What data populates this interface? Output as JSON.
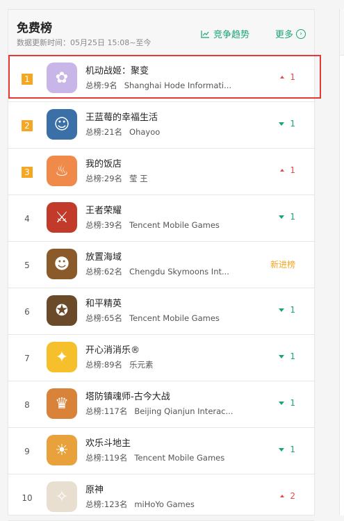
{
  "header": {
    "title": "免费榜",
    "update_time": "数据更新时间：05月25日 15:08~至今",
    "trend_label": "竞争趋势",
    "more_label": "更多"
  },
  "rows": [
    {
      "rank": "1",
      "name": "机动战姬：聚变",
      "overall": "总榜:9名",
      "developer": "Shanghai Hode Informati...",
      "change": "1",
      "direction": "up",
      "icon": "anime-girl-icon",
      "icon_color": "#c8b6e8"
    },
    {
      "rank": "2",
      "name": "王蓝莓的幸福生活",
      "overall": "总榜:21名",
      "developer": "Ohayoo",
      "change": "1",
      "direction": "down",
      "icon": "cartoon-boy-icon",
      "icon_color": "#3a6fa8"
    },
    {
      "rank": "3",
      "name": "我的饭店",
      "overall": "总榜:29名",
      "developer": "莹 王",
      "change": "1",
      "direction": "up",
      "icon": "chef-girl-icon",
      "icon_color": "#f08a4b"
    },
    {
      "rank": "4",
      "name": "王者荣耀",
      "overall": "总榜:39名",
      "developer": "Tencent Mobile Games",
      "change": "1",
      "direction": "down",
      "icon": "hero-warrior-icon",
      "icon_color": "#c23a2a"
    },
    {
      "rank": "5",
      "name": "放置海域",
      "overall": "总榜:62名",
      "developer": "Chengdu Skymoons Int...",
      "change": "新进榜",
      "direction": "new",
      "icon": "man-portrait-icon",
      "icon_color": "#8a5a2b"
    },
    {
      "rank": "6",
      "name": "和平精英",
      "overall": "总榜:65名",
      "developer": "Tencent Mobile Games",
      "change": "1",
      "direction": "down",
      "icon": "soldier-icon",
      "icon_color": "#6b4a2a"
    },
    {
      "rank": "7",
      "name": "开心消消乐®",
      "overall": "总榜:89名",
      "developer": "乐元素",
      "change": "1",
      "direction": "down",
      "icon": "chick-icon",
      "icon_color": "#f6c02c"
    },
    {
      "rank": "8",
      "name": "塔防镇魂师-古今大战",
      "overall": "总榜:117名",
      "developer": "Beijing Qianjun Interac...",
      "change": "1",
      "direction": "down",
      "icon": "fantasy-hero-icon",
      "icon_color": "#d9823a"
    },
    {
      "rank": "9",
      "name": "欢乐斗地主",
      "overall": "总榜:119名",
      "developer": "Tencent Mobile Games",
      "change": "1",
      "direction": "down",
      "icon": "farmer-icon",
      "icon_color": "#e9a23b"
    },
    {
      "rank": "10",
      "name": "原神",
      "overall": "总榜:123名",
      "developer": "miHoYo Games",
      "change": "2",
      "direction": "up",
      "icon": "fairy-icon",
      "icon_color": "#e9dfd0"
    }
  ]
}
